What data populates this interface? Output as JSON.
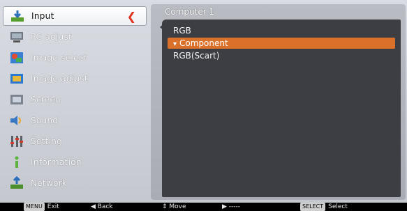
{
  "menu": {
    "items": [
      {
        "label": "Input",
        "icon": "input-icon",
        "selected": true
      },
      {
        "label": "PC adjust",
        "icon": "pc-adjust-icon"
      },
      {
        "label": "Image select",
        "icon": "image-select-icon"
      },
      {
        "label": "Image adjust",
        "icon": "image-adjust-icon"
      },
      {
        "label": "Screen",
        "icon": "screen-icon"
      },
      {
        "label": "Sound",
        "icon": "sound-icon"
      },
      {
        "label": "Setting",
        "icon": "setting-icon"
      },
      {
        "label": "Information",
        "icon": "information-icon"
      },
      {
        "label": "Network",
        "icon": "network-icon"
      }
    ]
  },
  "submenu": {
    "title": "Computer 1",
    "options": [
      {
        "label": "RGB",
        "active": false
      },
      {
        "label": "Component",
        "active": true
      },
      {
        "label": "RGB(Scart)",
        "active": false
      }
    ]
  },
  "footer": {
    "exit_key": "MENU",
    "exit_label": "Exit",
    "back_label": "Back",
    "move_label": "Move",
    "next_label": "-----",
    "select_key": "SELECT",
    "select_label": "Select"
  },
  "colors": {
    "highlight": "#d9712b",
    "list_bg": "#3c3e43",
    "panel_bg": "#c5c8cf"
  }
}
